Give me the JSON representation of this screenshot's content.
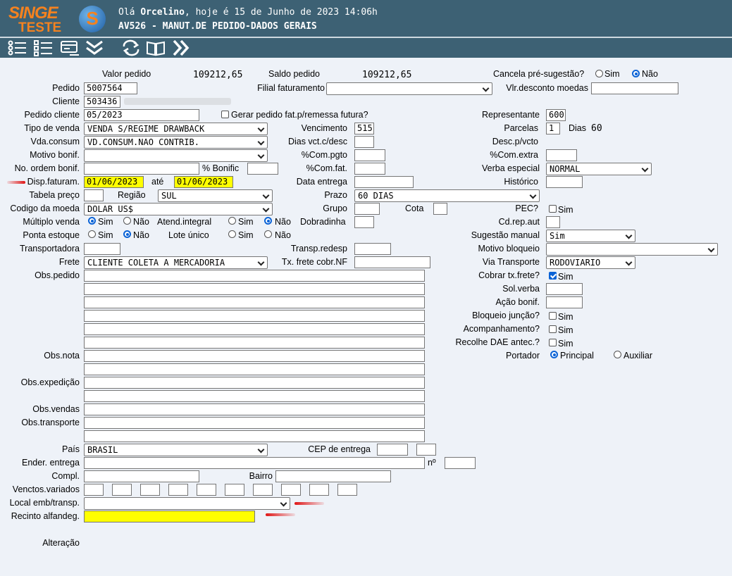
{
  "header": {
    "logo_line1": "SINGE",
    "logo_line2": "TESTE",
    "logo_icon": "S",
    "greeting_prefix": "Olá ",
    "user": "Orcelino",
    "greeting_suffix": ", hoje é 15 de Junho de 2023 14:06h",
    "program_title": "AV526 - MANUT.DE PEDIDO-DADOS GERAIS"
  },
  "toolbar": {
    "icons": [
      "list-icon",
      "checklist-icon",
      "card-icon",
      "chevron-down-double-icon",
      "refresh-icon",
      "book-icon",
      "chevron-right-double-icon"
    ]
  },
  "form": {
    "valor_pedido": {
      "label": "Valor pedido",
      "value": "109212,65"
    },
    "saldo_pedido": {
      "label": "Saldo pedido",
      "value": "109212,65"
    },
    "cancela_pre_sugestao": {
      "label": "Cancela pré-sugestão?",
      "opt1": "Sim",
      "opt2": "Não",
      "selected": "Não"
    },
    "pedido": {
      "label": "Pedido",
      "value": "5007564"
    },
    "filial_faturamento": {
      "label": "Filial faturamento",
      "value": ""
    },
    "vlr_desconto_moedas": {
      "label": "Vlr.desconto moedas",
      "value": ""
    },
    "cliente": {
      "label": "Cliente",
      "value": "503436"
    },
    "pedido_cliente": {
      "label": "Pedido cliente",
      "value": "05/2023"
    },
    "gerar_pedido_fat": {
      "label": "Gerar pedido fat.p/remessa futura?",
      "checked": false
    },
    "representante": {
      "label": "Representante",
      "value": "600"
    },
    "tipo_venda": {
      "label": "Tipo de venda",
      "value": "VENDA S/REGIME DRAWBACK"
    },
    "vencimento": {
      "label": "Vencimento",
      "value": "515"
    },
    "parcelas": {
      "label": "Parcelas",
      "value": "1",
      "dias_label": "Dias",
      "dias_value": "60"
    },
    "vda_consum": {
      "label": "Vda.consum",
      "value": "VD.CONSUM.NAO CONTRIB."
    },
    "dias_vct_desc": {
      "label": "Dias vct.c/desc",
      "value": ""
    },
    "desc_p_vcto": {
      "label": "Desc.p/vcto"
    },
    "motivo_bonif": {
      "label": "Motivo bonif.",
      "value": ""
    },
    "com_pgto": {
      "label": "%Com.pgto",
      "value": ""
    },
    "com_extra": {
      "label": "%Com.extra",
      "value": ""
    },
    "no_ordem_bonif": {
      "label": "No. ordem bonif.",
      "value": ""
    },
    "pct_bonific": {
      "label": "% Bonific",
      "value": ""
    },
    "com_fat": {
      "label": "%Com.fat.",
      "value": ""
    },
    "verba_especial": {
      "label": "Verba especial",
      "value": "NORMAL"
    },
    "disp_faturam": {
      "label": "Disp.faturam.",
      "from": "01/06/2023",
      "ate_label": "até",
      "to": "01/06/2023"
    },
    "data_entrega": {
      "label": "Data entrega",
      "value": ""
    },
    "historico": {
      "label": "Histórico",
      "value": ""
    },
    "tabela_preco": {
      "label": "Tabela preço",
      "value": ""
    },
    "regiao": {
      "label": "Região",
      "value": "SUL"
    },
    "prazo": {
      "label": "Prazo",
      "value": "60 DIAS"
    },
    "codigo_moeda": {
      "label": "Codigo da moeda",
      "value": "DOLAR US$"
    },
    "grupo": {
      "label": "Grupo",
      "value": ""
    },
    "cota": {
      "label": "Cota",
      "value": ""
    },
    "pec": {
      "label": "PEC?",
      "opt": "Sim",
      "checked": false
    },
    "multiplo_venda": {
      "label": "Múltiplo venda",
      "opt1": "Sim",
      "opt2": "Não",
      "selected": "Sim"
    },
    "atend_integral": {
      "label": "Atend.integral",
      "opt1": "Sim",
      "opt2": "Não",
      "selected": "Não"
    },
    "dobradinha": {
      "label": "Dobradinha",
      "value": ""
    },
    "cd_rep_aut": {
      "label": "Cd.rep.aut",
      "value": ""
    },
    "ponta_estoque": {
      "label": "Ponta estoque",
      "opt1": "Sim",
      "opt2": "Não",
      "selected": "Não"
    },
    "lote_unico": {
      "label": "Lote único",
      "opt1": "Sim",
      "opt2": "Não",
      "selected": ""
    },
    "sugestao_manual": {
      "label": "Sugestão manual",
      "value": "Sim"
    },
    "transportadora": {
      "label": "Transportadora",
      "value": ""
    },
    "transp_redesp": {
      "label": "Transp.redesp",
      "value": ""
    },
    "motivo_bloqueio": {
      "label": "Motivo bloqueio",
      "value": ""
    },
    "frete": {
      "label": "Frete",
      "value": "CLIENTE COLETA A MERCADORIA"
    },
    "tx_frete_cobr_nf": {
      "label": "Tx. frete cobr.NF",
      "value": ""
    },
    "via_transporte": {
      "label": "Via Transporte",
      "value": "RODOVIARIO"
    },
    "obs_pedido": {
      "label": "Obs.pedido"
    },
    "cobrar_tx_frete": {
      "label": "Cobrar tx.frete?",
      "opt": "Sim",
      "checked": true
    },
    "sol_verba": {
      "label": "Sol.verba",
      "value": ""
    },
    "acao_bonif": {
      "label": "Ação bonif.",
      "value": ""
    },
    "bloqueio_juncao": {
      "label": "Bloqueio junção?",
      "opt": "Sim",
      "checked": false
    },
    "acompanhamento": {
      "label": "Acompanhamento?",
      "opt": "Sim",
      "checked": false
    },
    "recolhe_dae": {
      "label": "Recolhe DAE antec.?",
      "opt": "Sim",
      "checked": false
    },
    "obs_nota": {
      "label": "Obs.nota"
    },
    "portador": {
      "label": "Portador",
      "opt1": "Principal",
      "opt2": "Auxiliar",
      "selected": "Principal"
    },
    "obs_expedicao": {
      "label": "Obs.expedição"
    },
    "obs_vendas": {
      "label": "Obs.vendas"
    },
    "obs_transporte": {
      "label": "Obs.transporte"
    },
    "pais": {
      "label": "País",
      "value": "BRASIL"
    },
    "cep_entrega": {
      "label": "CEP de entrega",
      "value1": "",
      "value2": ""
    },
    "ender_entrega": {
      "label": "Ender. entrega",
      "value": "",
      "no_label": "nº",
      "no_value": ""
    },
    "compl": {
      "label": "Compl.",
      "value": ""
    },
    "bairro": {
      "label": "Bairro",
      "value": ""
    },
    "venctos_variados": {
      "label": "Venctos.variados"
    },
    "local_emb": {
      "label": "Local emb/transp.",
      "value": ""
    },
    "recinto_alfandeg": {
      "label": "Recinto alfandeg.",
      "value": ""
    },
    "alteracao": {
      "label": "Alteração"
    }
  },
  "colors": {
    "header_bg": "#3d6174",
    "logo": "#f5821f",
    "highlight": "#ffff00",
    "arrow": "#e01515",
    "page_bg": "#eef2f8"
  }
}
